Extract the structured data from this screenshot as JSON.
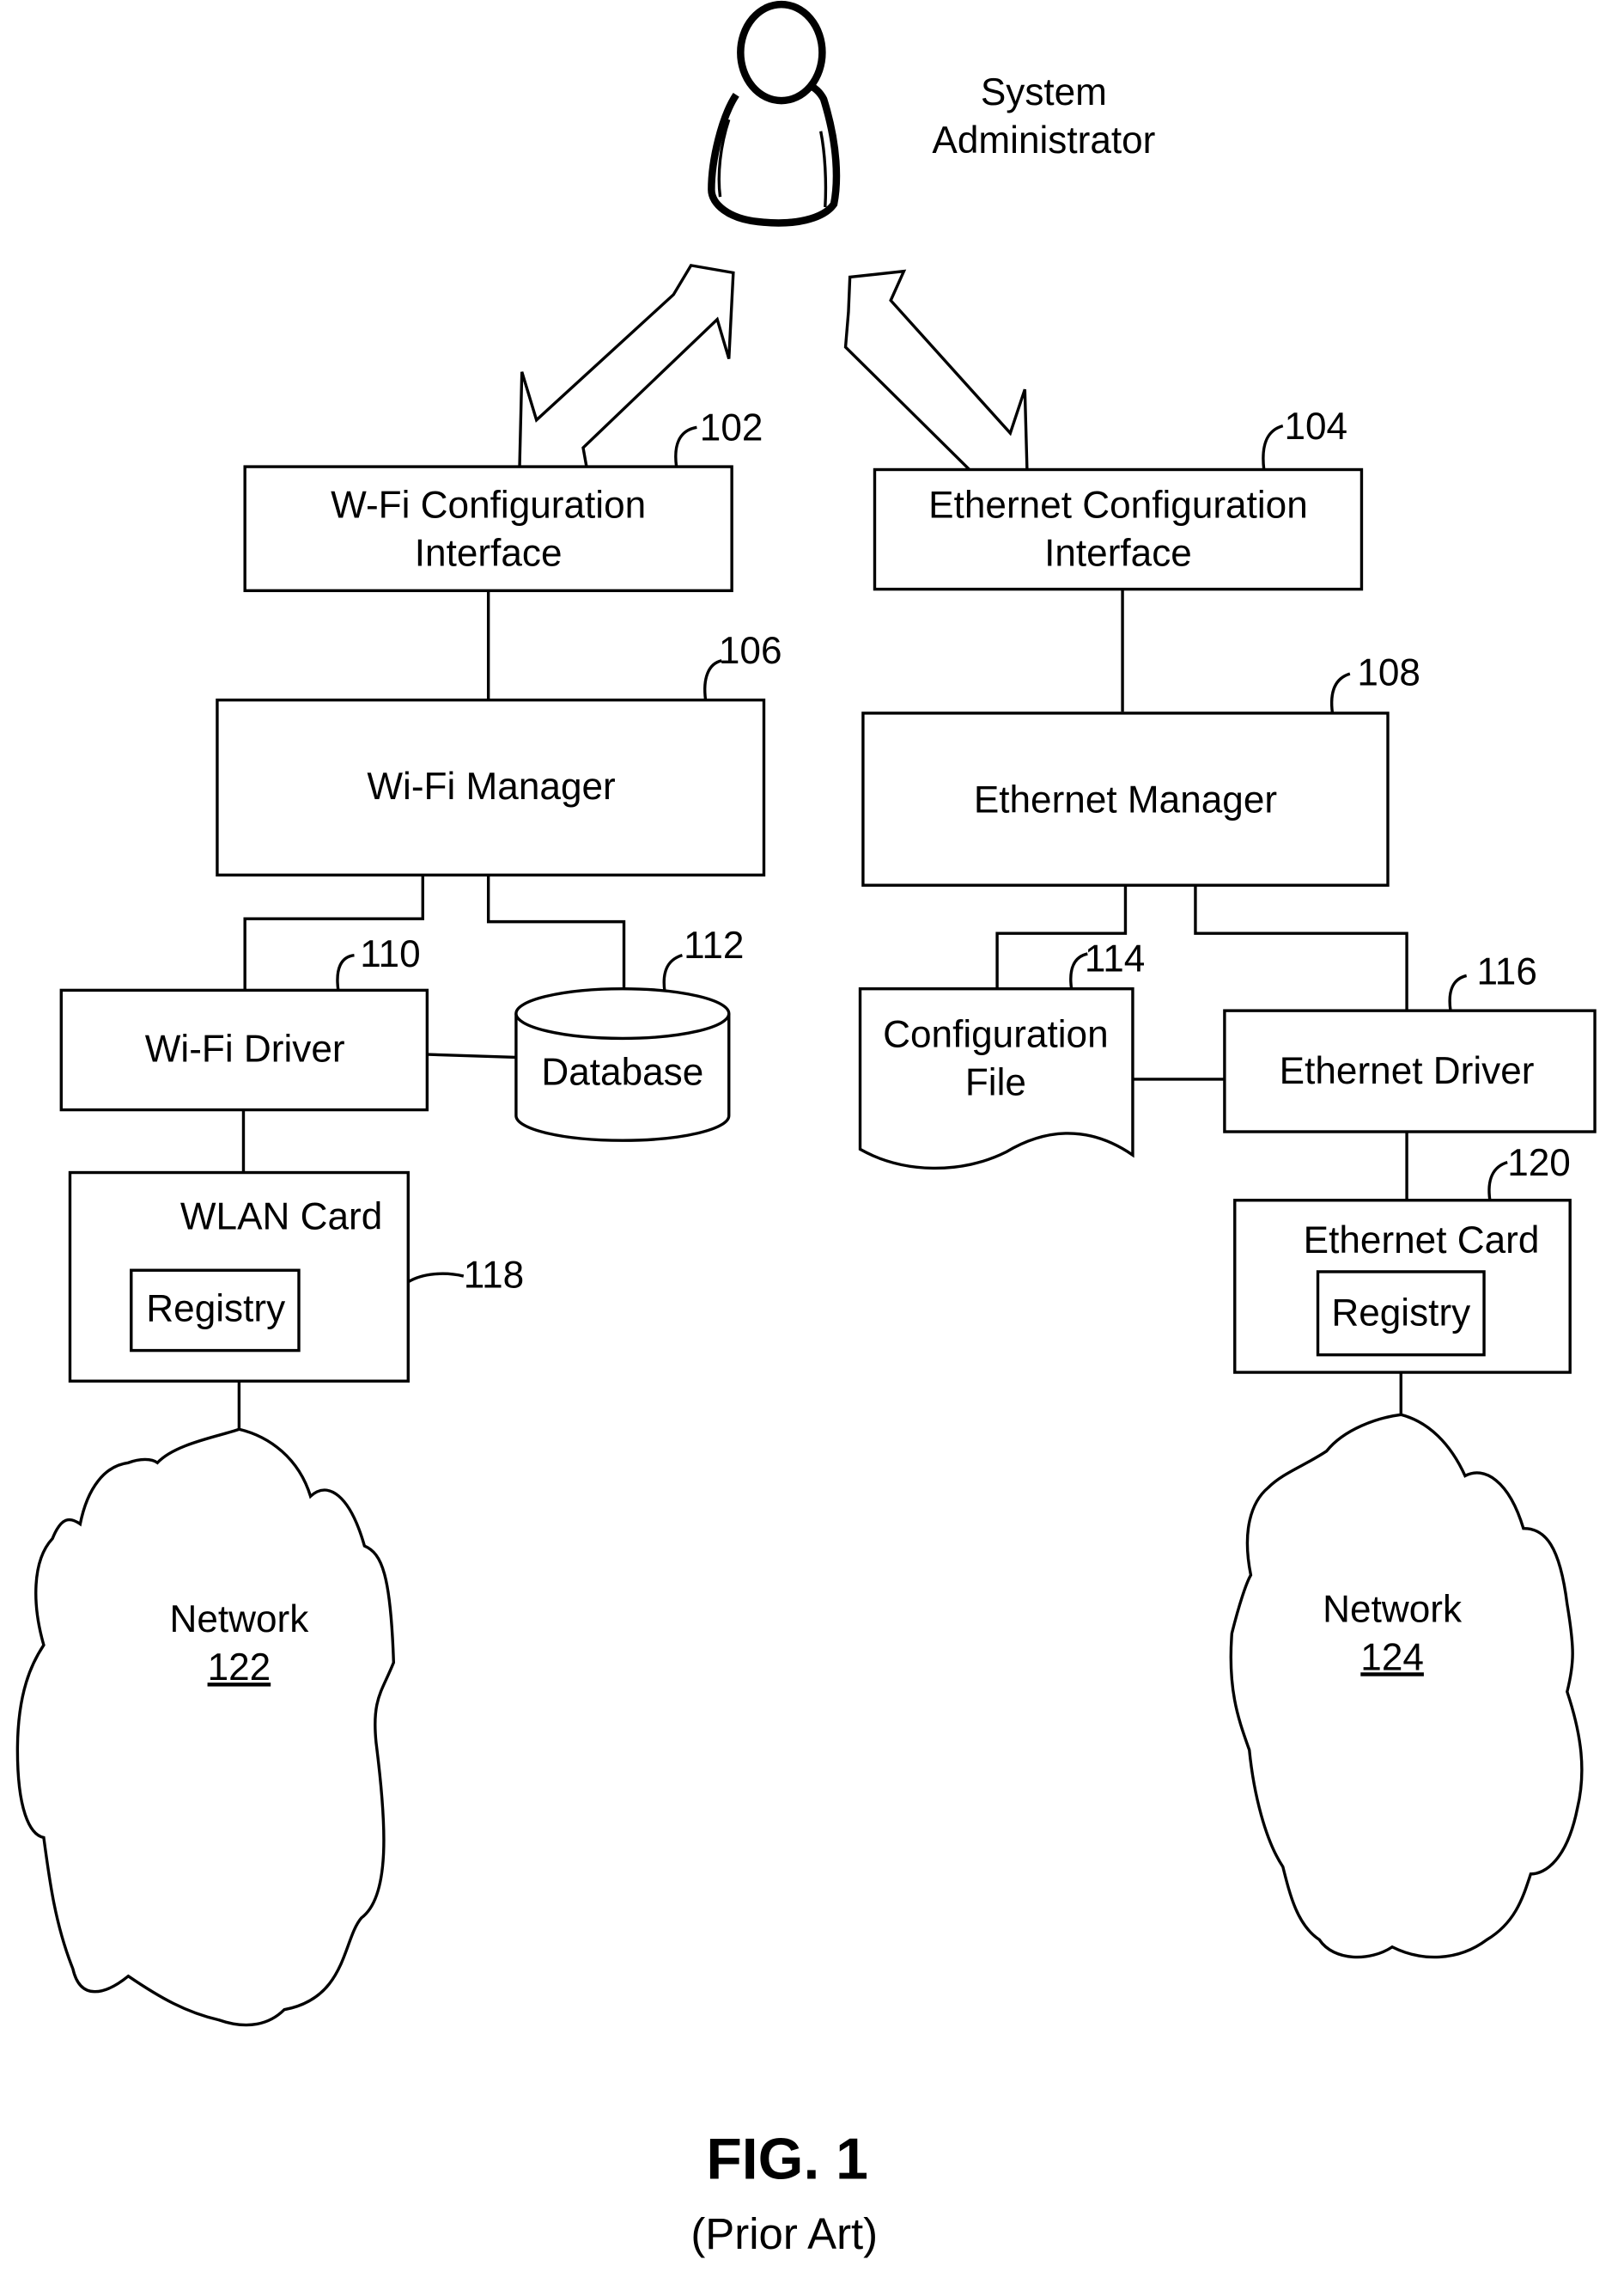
{
  "actor": {
    "label_line1": "System",
    "label_line2": "Administrator",
    "icon": "person-icon"
  },
  "nodes": {
    "wifi_config": {
      "line1": "W-Fi Configuration",
      "line2": "Interface",
      "ref": "102"
    },
    "eth_config": {
      "line1": "Ethernet Configuration",
      "line2": "Interface",
      "ref": "104"
    },
    "wifi_manager": {
      "label": "Wi-Fi Manager",
      "ref": "106"
    },
    "eth_manager": {
      "label": "Ethernet Manager",
      "ref": "108"
    },
    "wifi_driver": {
      "label": "Wi-Fi Driver",
      "ref": "110"
    },
    "database": {
      "label": "Database",
      "ref": "112"
    },
    "config_file": {
      "line1": "Configuration",
      "line2": "File",
      "ref": "114"
    },
    "eth_driver": {
      "label": "Ethernet Driver",
      "ref": "116"
    },
    "wlan_card": {
      "label": "WLAN Card",
      "registry": "Registry",
      "ref": "118"
    },
    "eth_card": {
      "label": "Ethernet Card",
      "registry": "Registry",
      "ref": "120"
    },
    "network_left": {
      "label": "Network",
      "ref": "122"
    },
    "network_right": {
      "label": "Network",
      "ref": "124"
    }
  },
  "caption": {
    "title": "FIG. 1",
    "subtitle": "(Prior Art)"
  }
}
